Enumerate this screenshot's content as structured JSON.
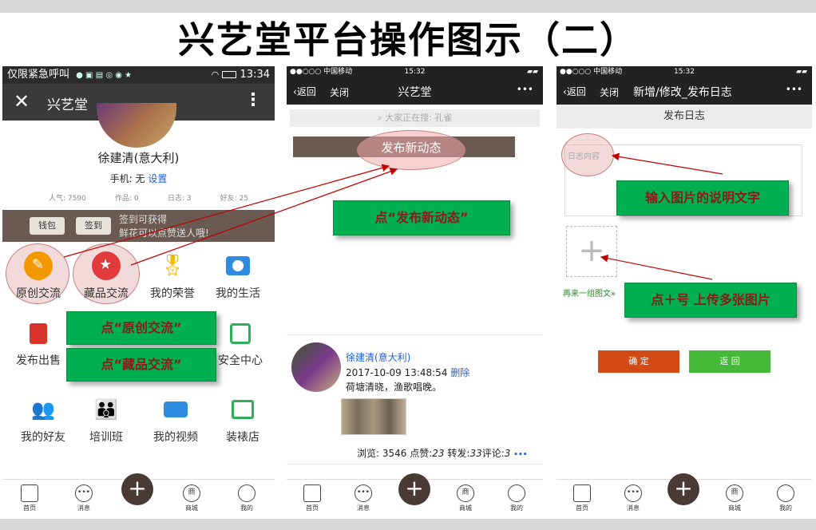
{
  "slide_title": "兴艺堂平台操作图示（二）",
  "p1": {
    "status_left": "仅限紧急呼叫",
    "status_time": "13:34",
    "app_title": "兴艺堂",
    "name": "徐建清(意大利)",
    "phone_label": "手机: 无",
    "phone_link": "设置",
    "stats": [
      "人气: 7590",
      "作品: 0",
      "日志: 3",
      "好友: 25"
    ],
    "wallet_btn": "钱包",
    "checkin_btn": "签到",
    "checkin_text1": "签到可获得",
    "checkin_text2": "鲜花可以点赞送人哦!",
    "grid": [
      {
        "label": "原创交流",
        "icon": "original-icon",
        "color": "#f39800"
      },
      {
        "label": "藏品交流",
        "icon": "collection-icon",
        "color": "#e03a3a"
      },
      {
        "label": "我的荣誉",
        "icon": "medal-icon",
        "color": "#f5b800"
      },
      {
        "label": "我的生活",
        "icon": "camera-icon",
        "color": "#2e8be0"
      },
      {
        "label": "发布出售",
        "icon": "bag-icon",
        "color": "#d9342b"
      },
      {
        "label": "安全中心",
        "icon": "shield-icon",
        "color": "#2fae5a"
      },
      {
        "label": "我的好友",
        "icon": "friends-icon",
        "color": "#2fae5a"
      },
      {
        "label": "培训班",
        "icon": "class-icon",
        "color": "#f08a00"
      },
      {
        "label": "我的视频",
        "icon": "video-icon",
        "color": "#2e8be0"
      },
      {
        "label": "装裱店",
        "icon": "frame-icon",
        "color": "#2fae5a"
      }
    ]
  },
  "tabs": [
    "首页",
    "消息",
    "",
    "商城",
    "我的"
  ],
  "tab_shop_glyph": "商",
  "plus_glyph": "+",
  "p2": {
    "carrier": "●●○○○ 中国移动",
    "time": "15:32",
    "back": "返回",
    "close": "关闭",
    "title": "兴艺堂",
    "more": "•••",
    "search_placeholder": "大家正在搜: 孔雀",
    "publish_btn": "发布新动态",
    "post_name": "徐建清(意大利)",
    "post_time": "2017-10-09 13:48:54",
    "post_delete": "删除",
    "post_text": "荷塘清晓，渔歌唱晚。",
    "post_views": "浏览: 3546",
    "post_likes_label": "点赞:",
    "post_likes": "23",
    "post_shares_label": "转发:",
    "post_shares": "33",
    "post_comments_label": "评论:",
    "post_comments": "3",
    "post_more": "•••"
  },
  "p3": {
    "carrier": "●●○○○ 中国移动",
    "time": "15:32",
    "back": "返回",
    "close": "关闭",
    "title": "新增/修改_发布日志",
    "more": "•••",
    "section": "发布日志",
    "content_placeholder": "日志内容",
    "add_more": "再来一组图文»",
    "confirm": "确 定",
    "back_btn": "返 回"
  },
  "callouts": {
    "publish": "点“发布新动态”",
    "original": "点“原创交流”",
    "collection": "点“藏品交流”",
    "caption": "输入图片的说明文字",
    "upload": "点＋号 上传多张图片"
  },
  "colors": {
    "confirm": "#d24a16",
    "back": "#46b83a",
    "callout": "#00b050",
    "callout_text": "#8b1a1a",
    "brown": "#6b5a52"
  }
}
